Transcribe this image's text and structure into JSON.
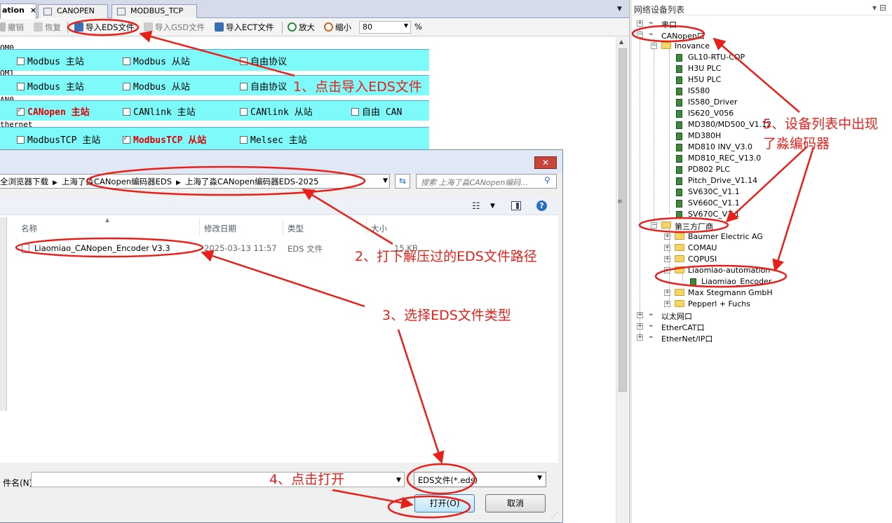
{
  "tabs": [
    {
      "label": "ation",
      "close": "×"
    },
    {
      "label": "CANOPEN"
    },
    {
      "label": "MODBUS_TCP"
    }
  ],
  "toolbar": {
    "undo": "撤销",
    "redo": "恢复",
    "import_eds": "导入EDS文件",
    "import_gsd": "导入GSD文件",
    "import_ect": "导入ECT文件",
    "zoom_in": "放大",
    "zoom_out": "缩小",
    "zoom_value": "80",
    "zoom_unit": "%"
  },
  "config": {
    "rows": [
      {
        "label": "OM0",
        "items": [
          {
            "label": "Modbus 主站",
            "checked": false
          },
          {
            "label": "Modbus 从站",
            "checked": false
          },
          {
            "label": "自由协议",
            "checked": false
          }
        ]
      },
      {
        "label": "OM1",
        "items": [
          {
            "label": "Modbus 主站",
            "checked": false
          },
          {
            "label": "Modbus 从站",
            "checked": false
          },
          {
            "label": "自由协议",
            "checked": false
          }
        ]
      },
      {
        "label": "AN0",
        "items": [
          {
            "label": "CANopen 主站",
            "checked": true
          },
          {
            "label": "CANlink 主站",
            "checked": false
          },
          {
            "label": "CANlink 从站",
            "checked": false
          },
          {
            "label": "自由 CAN",
            "checked": false
          }
        ]
      },
      {
        "label": "thernet",
        "items": [
          {
            "label": "ModbusTCP 主站",
            "checked": false
          },
          {
            "label": "ModbusTCP 从站",
            "checked": true
          },
          {
            "label": "Melsec 主站",
            "checked": false
          }
        ]
      }
    ]
  },
  "dialog": {
    "close": "✕",
    "breadcrumbs": [
      "全浏览器下载",
      "上海了淼CANopen编码器EDS",
      "上海了淼CANopen编码器EDS-2025"
    ],
    "search_placeholder": "搜索 上海了淼CANopen编码...",
    "columns": {
      "name": "名称",
      "date": "修改日期",
      "type": "类型",
      "size": "大小"
    },
    "file": {
      "name": "Liaomiao_CANopen_Encoder V3.3",
      "date": "2025-03-13 11:57",
      "type": "EDS 文件",
      "size": "15 KB"
    },
    "filename_label": "件名(N):",
    "filename_value": "",
    "filetype": "EDS文件(*.eds)",
    "open_button": "打开(O)",
    "cancel_button": "取消"
  },
  "panel": {
    "title": "网络设备列表",
    "pin": "▾ ⊟"
  },
  "tree": {
    "serial": "串口",
    "canopen": "CANopen口",
    "inovance": "Inovance",
    "inovance_devices": [
      "GL10-RTU-COP",
      "H3U PLC",
      "H5U PLC",
      "IS580",
      "IS580_Driver",
      "IS620_V056",
      "MD380/MD500_V1.12",
      "MD380H",
      "MD810 INV_V3.0",
      "MD810_REC_V13.0",
      "PD802 PLC",
      "Pitch_Drive_V1.14",
      "SV630C_V1.1",
      "SV660C_V1.1",
      "SV670C_V1.1"
    ],
    "third_party": "第三方厂商",
    "vendors": [
      "Baumer Electric AG",
      "COMAU",
      "CQPUSI",
      "Liaomiao-automation",
      "Max Stegmann GmbH",
      "Pepperl + Fuchs"
    ],
    "liaomiao_device": "Liaomiao_Encoder",
    "ethernet": "以太网口",
    "ethercat": "EtherCAT口",
    "ethernetip": "EtherNet/IP口"
  },
  "annotations": {
    "step1": "1、点击导入EDS文件",
    "step2": "2、打下解压过的EDS文件路径",
    "step3": "3、选择EDS文件类型",
    "step4": "4、点击打开",
    "step5_line1": "5、设备列表中出现",
    "step5_line2": "了淼编码器"
  },
  "colors": {
    "annotation": "#e8201a",
    "config_bg": "#7ffafa",
    "checked_label": "#e00000"
  }
}
